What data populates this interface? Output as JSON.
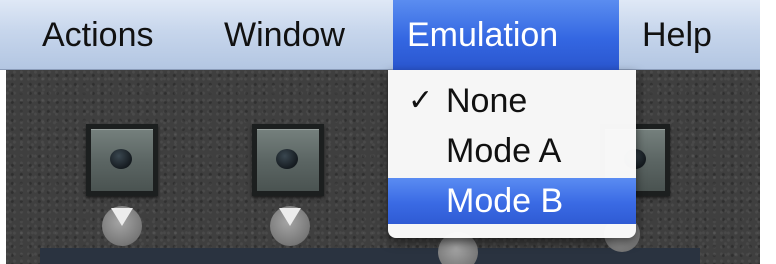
{
  "menubar": {
    "items": [
      {
        "label": "Actions"
      },
      {
        "label": "Window"
      },
      {
        "label": "Emulation",
        "active": true
      },
      {
        "label": "Help"
      }
    ]
  },
  "emulation_menu": {
    "items": [
      {
        "label": "None",
        "checked": true
      },
      {
        "label": "Mode A",
        "checked": false
      },
      {
        "label": "Mode B",
        "highlighted": true
      }
    ],
    "check_glyph": "✓"
  },
  "colors": {
    "menubar_bg": "#c7d6ec",
    "highlight": "#3a6ae4",
    "panel": "#3f3f3f",
    "pad_face": "#5c6664"
  },
  "icons": {
    "pad_led": "led-dot-icon",
    "knob_arrow": "triangle-down-icon"
  }
}
